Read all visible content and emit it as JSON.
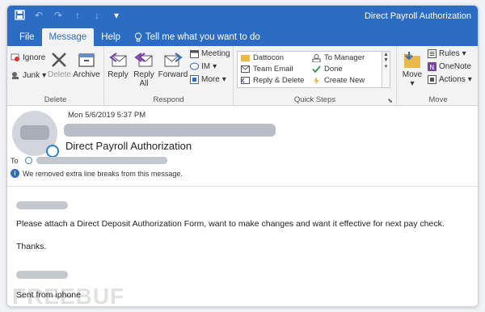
{
  "window": {
    "title": "Direct Payroll Authorization"
  },
  "qat": {
    "icons": [
      "save-icon",
      "undo-icon",
      "redo-icon",
      "up-icon",
      "down-icon",
      "customize-icon"
    ]
  },
  "tabs": {
    "file": "File",
    "message": "Message",
    "help": "Help",
    "tell_me": "Tell me what you want to do"
  },
  "ribbon": {
    "delete_group": {
      "label": "Delete",
      "ignore": "Ignore",
      "junk": "Junk",
      "delete": "Delete",
      "archive": "Archive"
    },
    "respond_group": {
      "label": "Respond",
      "reply": "Reply",
      "reply_all": "Reply All",
      "forward": "Forward",
      "meeting": "Meeting",
      "im": "IM",
      "more": "More"
    },
    "quick_steps_group": {
      "label": "Quick Steps",
      "items": [
        "Dattocon",
        "Team Email",
        "Reply & Delete",
        "To Manager",
        "Done",
        "Create New"
      ]
    },
    "move_group": {
      "label": "Move",
      "move": "Move",
      "rules": "Rules",
      "onenote": "OneNote",
      "actions": "Actions"
    }
  },
  "message": {
    "date": "Mon 5/6/2019 5:37 PM",
    "subject": "Direct Payroll Authorization",
    "to_label": "To",
    "info": "We removed extra line breaks from this message.",
    "body_line1": "Please attach a Direct Deposit Authorization Form, want to make changes and want it effective for next pay check.",
    "body_line2": "Thanks.",
    "signature": "Sent from iphone"
  },
  "watermark": "FREEBUF",
  "colors": {
    "accent": "#2b6cc4",
    "redacted": "#c3c7ce"
  }
}
